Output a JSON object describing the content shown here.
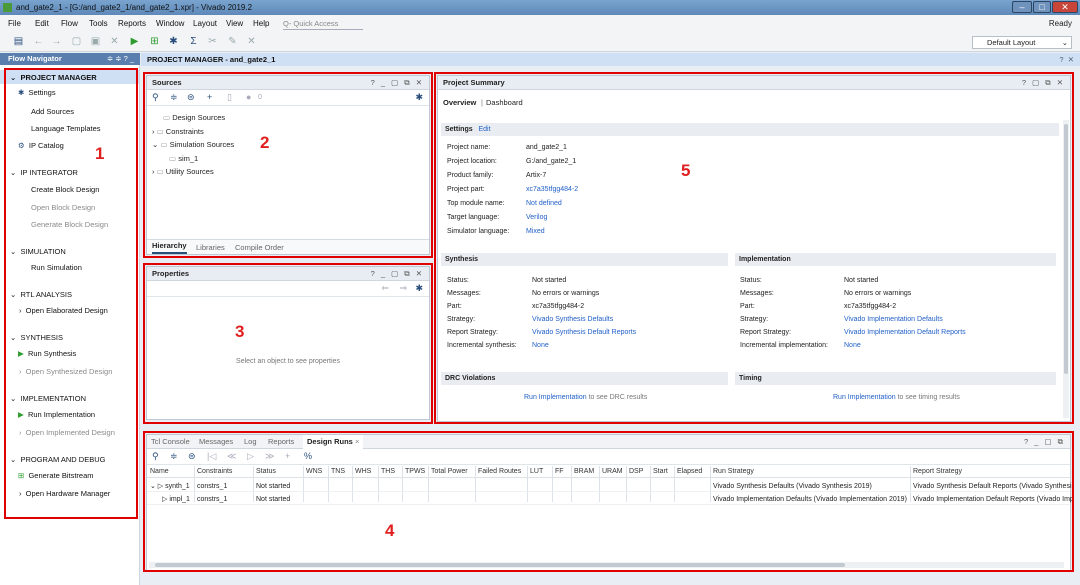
{
  "window": {
    "title": "and_gate2_1 - [G:/and_gate2_1/and_gate2_1.xpr] - Vivado 2019.2"
  },
  "menu": {
    "items": [
      "File",
      "Edit",
      "Flow",
      "Tools",
      "Reports",
      "Window",
      "Layout",
      "View",
      "Help"
    ],
    "quick_access_placeholder": "Q- Quick Access",
    "status": "Ready"
  },
  "toolbar": {
    "layout_select": "Default Layout"
  },
  "flow_navigator": {
    "title": "Flow Navigator",
    "sections": [
      {
        "label": "PROJECT MANAGER",
        "items": [
          "Settings",
          "Add Sources",
          "Language Templates",
          "IP Catalog"
        ]
      },
      {
        "label": "IP INTEGRATOR",
        "items": [
          "Create Block Design",
          "Open Block Design",
          "Generate Block Design"
        ]
      },
      {
        "label": "SIMULATION",
        "items": [
          "Run Simulation"
        ]
      },
      {
        "label": "RTL ANALYSIS",
        "items": [
          "Open Elaborated Design"
        ]
      },
      {
        "label": "SYNTHESIS",
        "items": [
          "Run Synthesis",
          "Open Synthesized Design"
        ]
      },
      {
        "label": "IMPLEMENTATION",
        "items": [
          "Run Implementation",
          "Open Implemented Design"
        ]
      },
      {
        "label": "PROGRAM AND DEBUG",
        "items": [
          "Generate Bitstream",
          "Open Hardware Manager"
        ]
      }
    ]
  },
  "main_header": "PROJECT MANAGER - and_gate2_1",
  "sources": {
    "title": "Sources",
    "badge": "0",
    "tree": [
      "Design Sources",
      "Constraints",
      "Simulation Sources",
      "sim_1",
      "Utility Sources"
    ],
    "tabs": [
      "Hierarchy",
      "Libraries",
      "Compile Order"
    ]
  },
  "properties": {
    "title": "Properties",
    "empty_message": "Select an object to see properties"
  },
  "project_summary": {
    "title": "Project Summary",
    "tabs": [
      "Overview",
      "Dashboard"
    ],
    "settings": {
      "title": "Settings",
      "edit": "Edit",
      "rows": [
        {
          "k": "Project name:",
          "v": "and_gate2_1"
        },
        {
          "k": "Project location:",
          "v": "G:/and_gate2_1"
        },
        {
          "k": "Product family:",
          "v": "Artix-7"
        },
        {
          "k": "Project part:",
          "v": "xc7a35tfgg484-2"
        },
        {
          "k": "Top module name:",
          "v": "Not defined"
        },
        {
          "k": "Target language:",
          "v": "Verilog"
        },
        {
          "k": "Simulator language:",
          "v": "Mixed"
        }
      ]
    },
    "synthesis": {
      "title": "Synthesis",
      "rows": [
        {
          "k": "Status:",
          "v": "Not started"
        },
        {
          "k": "Messages:",
          "v": "No errors or warnings"
        },
        {
          "k": "Part:",
          "v": "xc7a35tfgg484-2"
        },
        {
          "k": "Strategy:",
          "v": "Vivado Synthesis Defaults"
        },
        {
          "k": "Report Strategy:",
          "v": "Vivado Synthesis Default Reports"
        },
        {
          "k": "Incremental synthesis:",
          "v": "None"
        }
      ]
    },
    "implementation": {
      "title": "Implementation",
      "rows": [
        {
          "k": "Status:",
          "v": "Not started"
        },
        {
          "k": "Messages:",
          "v": "No errors or warnings"
        },
        {
          "k": "Part:",
          "v": "xc7a35tfgg484-2"
        },
        {
          "k": "Strategy:",
          "v": "Vivado Implementation Defaults"
        },
        {
          "k": "Report Strategy:",
          "v": "Vivado Implementation Default Reports"
        },
        {
          "k": "Incremental implementation:",
          "v": "None"
        }
      ]
    },
    "drc": {
      "title": "DRC Violations",
      "link": "Run Implementation",
      "text": "to see DRC results"
    },
    "timing": {
      "title": "Timing",
      "link": "Run Implementation",
      "text": "to see timing results"
    }
  },
  "runs": {
    "tabs": [
      "Tcl Console",
      "Messages",
      "Log",
      "Reports",
      "Design Runs"
    ],
    "columns": [
      "Name",
      "Constraints",
      "Status",
      "WNS",
      "TNS",
      "WHS",
      "THS",
      "TPWS",
      "Total Power",
      "Failed Routes",
      "LUT",
      "FF",
      "BRAM",
      "URAM",
      "DSP",
      "Start",
      "Elapsed",
      "Run Strategy",
      "Report Strategy"
    ],
    "rows": [
      {
        "name": "synth_1",
        "constraints": "constrs_1",
        "status": "Not started",
        "run_strategy": "Vivado Synthesis Defaults (Vivado Synthesis 2019)",
        "report_strategy": "Vivado Synthesis Default Reports (Vivado Synthesi"
      },
      {
        "name": "impl_1",
        "constraints": "constrs_1",
        "status": "Not started",
        "run_strategy": "Vivado Implementation Defaults (Vivado Implementation 2019)",
        "report_strategy": "Vivado Implementation Default Reports (Vivado Imp"
      }
    ]
  },
  "annotations": [
    "1",
    "2",
    "3",
    "4",
    "5"
  ],
  "colors": {
    "annotation": "#e00000",
    "link": "#2260c8",
    "accent": "#5a7fae"
  }
}
